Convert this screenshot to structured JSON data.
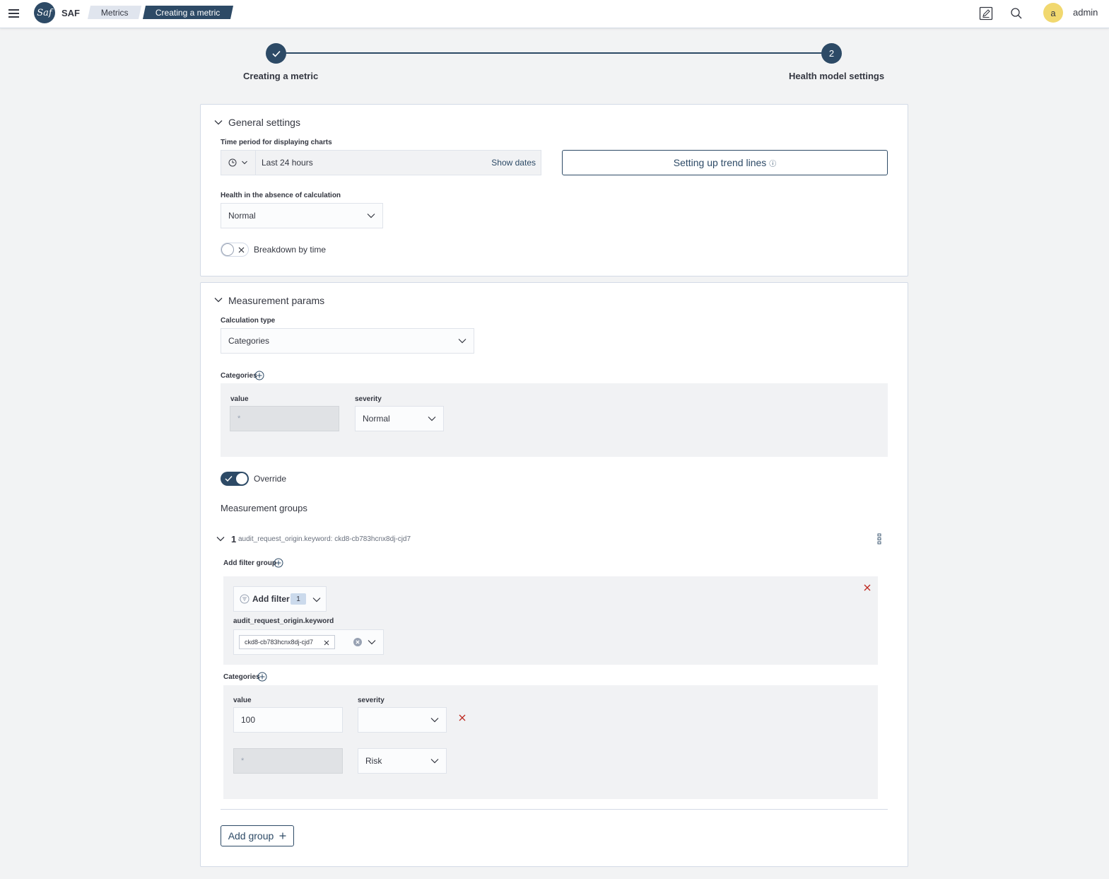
{
  "header": {
    "app_name": "SAF",
    "logo_text": "Saf",
    "breadcrumbs": [
      "Metrics",
      "Creating a metric"
    ],
    "user_initial": "a",
    "username": "admin"
  },
  "stepper": {
    "step1_label": "Creating a metric",
    "step2_number": "2",
    "step2_label": "Health model settings"
  },
  "general": {
    "title": "General settings",
    "time_period_label": "Time period for displaying charts",
    "time_period_value": "Last 24 hours",
    "show_dates": "Show dates",
    "trend_button": "Setting up trend lines",
    "trend_info": "ⓘ",
    "health_label": "Health in the absence of calculation",
    "health_value": "Normal",
    "breakdown_label": "Breakdown by time",
    "breakdown_on": false
  },
  "measurement": {
    "title": "Measurement params",
    "calc_type_label": "Calculation type",
    "calc_type_value": "Categories",
    "categories_label": "Categories",
    "cat_value_header": "value",
    "cat_severity_header": "severity",
    "default_category": {
      "value": "*",
      "severity": "Normal"
    },
    "override_label": "Override",
    "override_on": true,
    "groups_title": "Measurement groups",
    "group": {
      "number": "1",
      "description": "audit_request_origin.keyword: ckd8-cb783hcnx8dj-cjd7",
      "add_filter_group_label": "Add filter group",
      "add_filter_label": "Add filter",
      "filter_count": "1",
      "filter_field_label": "audit_request_origin.keyword",
      "filter_chip": "ckd8-cb783hcnx8dj-cjd7",
      "categories_label": "Categories",
      "value_header": "value",
      "severity_header": "severity",
      "rows": [
        {
          "value": "100",
          "severity": ""
        },
        {
          "value": "*",
          "severity": "Risk"
        }
      ]
    },
    "add_group_button": "Add group"
  },
  "colors": {
    "primary": "#2d4a66",
    "danger": "#bd271e",
    "avatar": "#f1d86f"
  }
}
